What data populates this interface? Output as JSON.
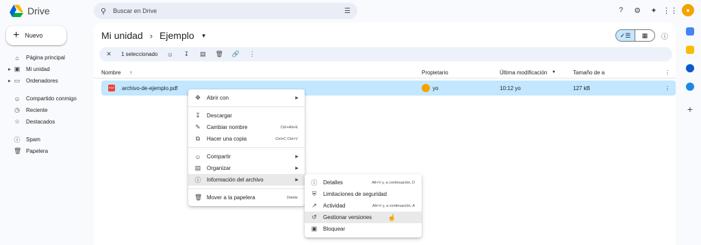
{
  "app": {
    "name": "Drive"
  },
  "search": {
    "placeholder": "Buscar en Drive"
  },
  "sidebar": {
    "new_label": "Nuevo",
    "items": [
      {
        "label": "Página principal",
        "icon": "home-icon"
      },
      {
        "label": "Mi unidad",
        "icon": "drive-icon"
      },
      {
        "label": "Ordenadores",
        "icon": "computer-icon"
      },
      {
        "label": "Compartido conmigo",
        "icon": "people-icon"
      },
      {
        "label": "Reciente",
        "icon": "clock-icon"
      },
      {
        "label": "Destacados",
        "icon": "star-icon"
      },
      {
        "label": "Spam",
        "icon": "spam-icon"
      },
      {
        "label": "Papelera",
        "icon": "trash-icon"
      }
    ]
  },
  "breadcrumb": {
    "root": "Mi unidad",
    "current": "Ejemplo"
  },
  "selection": {
    "label": "1 seleccionado"
  },
  "table": {
    "headers": [
      "Nombre",
      "Propietario",
      "Última modificación",
      "Tamaño de a"
    ],
    "row": {
      "name": "archivo-de-ejemplo.pdf",
      "owner": "yo",
      "modified": "10:12 yo",
      "size": "127 kB",
      "file_badge": "PDF"
    }
  },
  "context_menu": {
    "items": [
      {
        "label": "Abrir con",
        "shortcut": "",
        "icon": "move-icon"
      },
      {
        "label": "Descargar",
        "shortcut": "",
        "icon": "download-icon"
      },
      {
        "label": "Cambiar nombre",
        "shortcut": "Ctrl+Alt+E",
        "icon": "rename-icon"
      },
      {
        "label": "Hacer una copia",
        "shortcut": "Ctrl+C Ctrl+V",
        "icon": "copy-icon"
      },
      {
        "label": "Compartir",
        "shortcut": "",
        "icon": "share-icon"
      },
      {
        "label": "Organizar",
        "shortcut": "",
        "icon": "folder-icon"
      },
      {
        "label": "Información del archivo",
        "shortcut": "",
        "icon": "info-icon"
      },
      {
        "label": "Mover a la papelera",
        "shortcut": "Delete",
        "icon": "trash-icon"
      }
    ]
  },
  "submenu": {
    "items": [
      {
        "label": "Detalles",
        "shortcut": "Alt+V y, a continuación, D"
      },
      {
        "label": "Limitaciones de seguridad",
        "shortcut": ""
      },
      {
        "label": "Actividad",
        "shortcut": "Alt+V y, a continuación, A"
      },
      {
        "label": "Gestionar versiones",
        "shortcut": ""
      },
      {
        "label": "Bloquear",
        "shortcut": ""
      }
    ]
  },
  "colors": {
    "selected_row": "#c2e7ff",
    "accent": "#0b57d0",
    "avatar": "#f4a300"
  }
}
